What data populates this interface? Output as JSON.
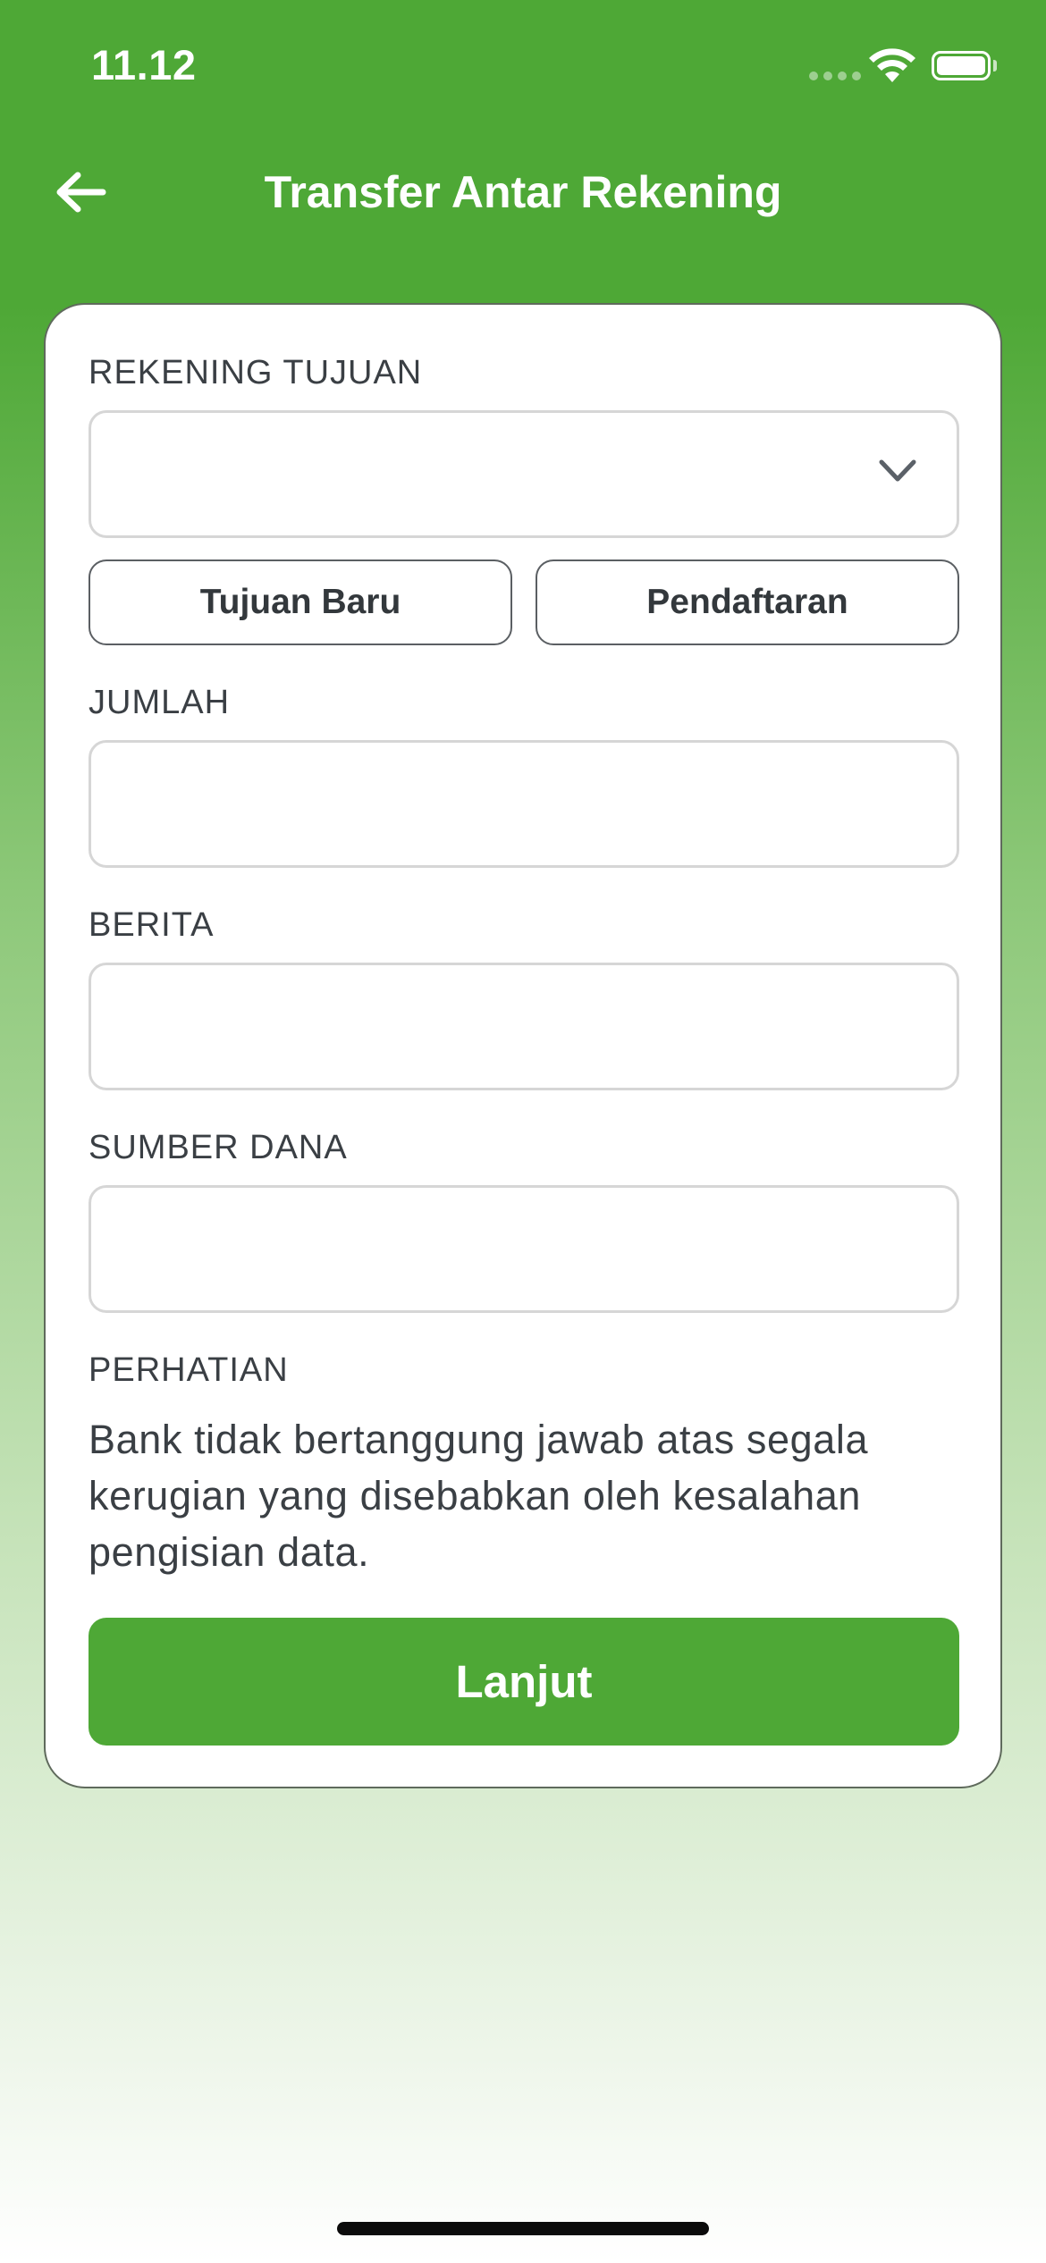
{
  "status_bar": {
    "time": "11.12"
  },
  "header": {
    "title": "Transfer Antar Rekening",
    "back_icon": "arrow-left-icon"
  },
  "form": {
    "destination": {
      "label": "REKENING TUJUAN",
      "value": "",
      "dropdown_icon": "chevron-down-icon"
    },
    "buttons": {
      "new_destination": "Tujuan Baru",
      "registration": "Pendaftaran"
    },
    "amount": {
      "label": "JUMLAH",
      "value": ""
    },
    "message": {
      "label": "BERITA",
      "value": ""
    },
    "source_of_funds": {
      "label": "SUMBER DANA",
      "value": ""
    },
    "notice": {
      "label": "PERHATIAN",
      "text": "Bank tidak bertanggung jawab atas segala kerugian yang disebabkan oleh kesalahan pengisian data."
    },
    "submit_label": "Lanjut"
  },
  "colors": {
    "brand_green": "#4ea836",
    "card_background": "#ffffff",
    "label_text": "#3a3f44"
  }
}
